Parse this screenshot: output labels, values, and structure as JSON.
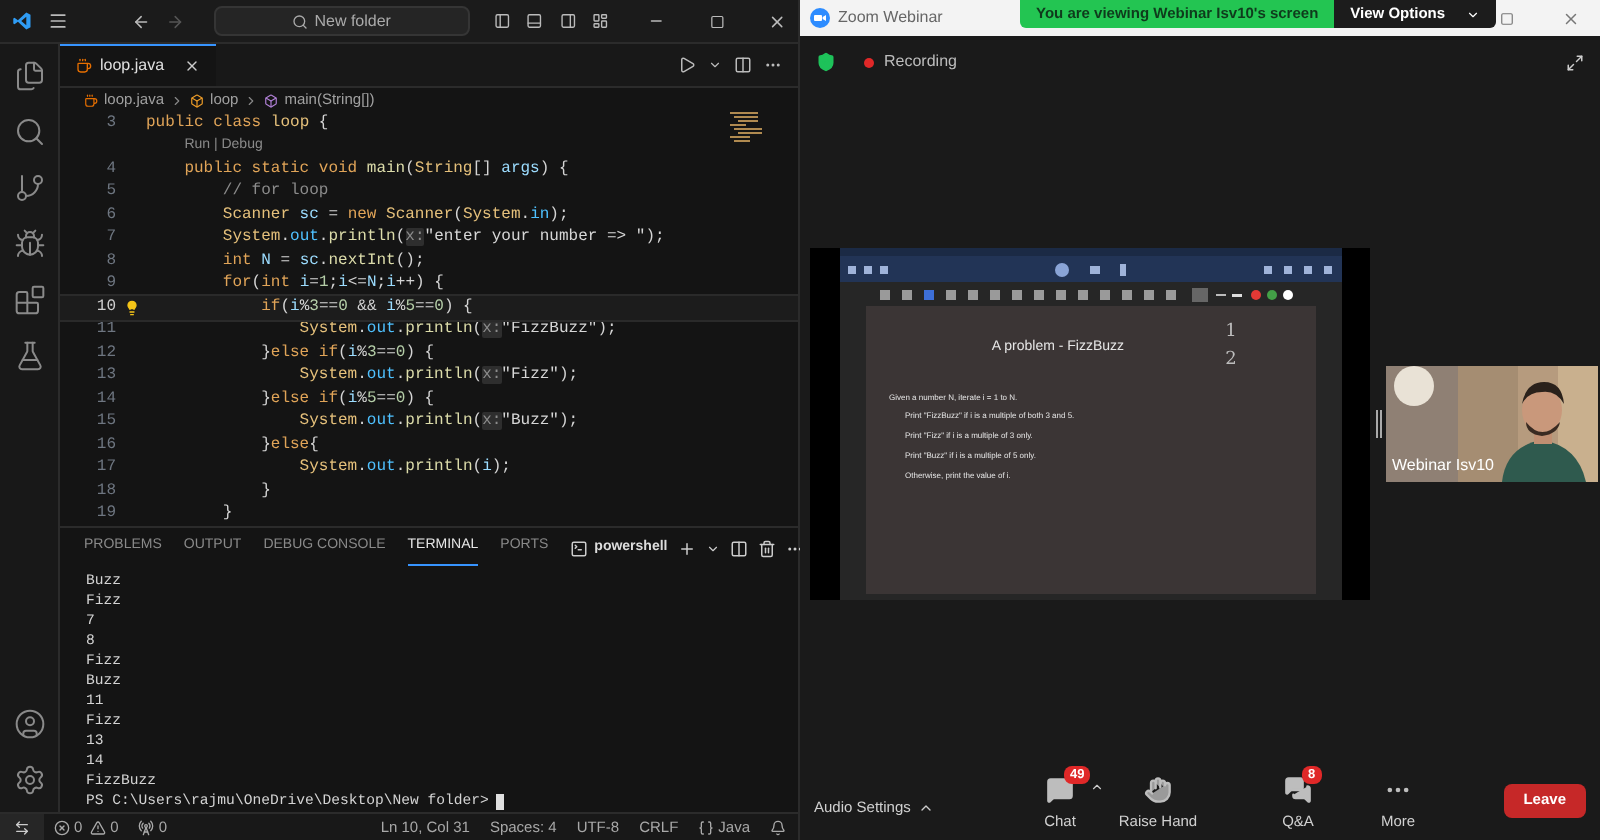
{
  "vscode": {
    "search": "New folder",
    "tab": {
      "label": "loop.java"
    },
    "breadcrumb": [
      "loop.java",
      "loop",
      "main(String[])"
    ],
    "code": [
      {
        "kind": "code",
        "number": "3",
        "current": false,
        "tokens": [
          {
            "kind": "kw",
            "text": "public class "
          },
          {
            "kind": "type",
            "text": "loop"
          },
          {
            "kind": "p",
            "text": " {"
          }
        ]
      },
      {
        "kind": "codelens",
        "text": "    Run | Debug"
      },
      {
        "kind": "code",
        "number": "4",
        "current": false,
        "tokens": [
          {
            "kind": "kw",
            "text": "    public static void "
          },
          {
            "kind": "fn",
            "text": "main"
          },
          {
            "kind": "p",
            "text": "("
          },
          {
            "kind": "type",
            "text": "String"
          },
          {
            "kind": "p",
            "text": "[] "
          },
          {
            "kind": "var",
            "text": "args"
          },
          {
            "kind": "p",
            "text": ") {"
          }
        ]
      },
      {
        "kind": "code",
        "number": "5",
        "current": false,
        "tokens": [
          {
            "kind": "com",
            "text": "        // for loop"
          }
        ]
      },
      {
        "kind": "code",
        "number": "6",
        "current": false,
        "tokens": [
          {
            "kind": "type",
            "text": "        Scanner "
          },
          {
            "kind": "var",
            "text": "sc"
          },
          {
            "kind": "p",
            "text": " = "
          },
          {
            "kind": "kw",
            "text": "new "
          },
          {
            "kind": "type",
            "text": "Scanner"
          },
          {
            "kind": "p",
            "text": "("
          },
          {
            "kind": "type",
            "text": "System"
          },
          {
            "kind": "p",
            "text": "."
          },
          {
            "kind": "field",
            "text": "in"
          },
          {
            "kind": "p",
            "text": ");"
          }
        ]
      },
      {
        "kind": "code",
        "number": "7",
        "current": false,
        "tokens": [
          {
            "kind": "type",
            "text": "        System"
          },
          {
            "kind": "p",
            "text": "."
          },
          {
            "kind": "field",
            "text": "out"
          },
          {
            "kind": "p",
            "text": "."
          },
          {
            "kind": "fn",
            "text": "println"
          },
          {
            "kind": "p",
            "text": "("
          },
          {
            "kind": "hint",
            "text": "x:"
          },
          {
            "kind": "str",
            "text": "\"enter your number => \""
          },
          {
            "kind": "p",
            "text": ");"
          }
        ]
      },
      {
        "kind": "code",
        "number": "8",
        "current": false,
        "tokens": [
          {
            "kind": "kw",
            "text": "        int "
          },
          {
            "kind": "var",
            "text": "N"
          },
          {
            "kind": "p",
            "text": " = "
          },
          {
            "kind": "var",
            "text": "sc"
          },
          {
            "kind": "p",
            "text": "."
          },
          {
            "kind": "fn",
            "text": "nextInt"
          },
          {
            "kind": "p",
            "text": "();"
          }
        ]
      },
      {
        "kind": "code",
        "number": "9",
        "current": false,
        "tokens": [
          {
            "kind": "kw",
            "text": "        for"
          },
          {
            "kind": "p",
            "text": "("
          },
          {
            "kind": "kw",
            "text": "int "
          },
          {
            "kind": "var",
            "text": "i"
          },
          {
            "kind": "p",
            "text": "="
          },
          {
            "kind": "num",
            "text": "1"
          },
          {
            "kind": "p",
            "text": ";"
          },
          {
            "kind": "var",
            "text": "i"
          },
          {
            "kind": "p",
            "text": "<="
          },
          {
            "kind": "var",
            "text": "N"
          },
          {
            "kind": "p",
            "text": ";"
          },
          {
            "kind": "var",
            "text": "i"
          },
          {
            "kind": "p",
            "text": "++) {"
          }
        ]
      },
      {
        "kind": "code",
        "number": "10",
        "current": true,
        "tokens": [
          {
            "kind": "kw",
            "text": "            if"
          },
          {
            "kind": "p",
            "text": "("
          },
          {
            "kind": "var",
            "text": "i"
          },
          {
            "kind": "p",
            "text": "%"
          },
          {
            "kind": "num",
            "text": "3"
          },
          {
            "kind": "p",
            "text": "=="
          },
          {
            "kind": "num",
            "text": "0"
          },
          {
            "kind": "p",
            "text": " && "
          },
          {
            "kind": "var",
            "text": "i"
          },
          {
            "kind": "p",
            "text": "%"
          },
          {
            "kind": "num",
            "text": "5"
          },
          {
            "kind": "p",
            "text": "=="
          },
          {
            "kind": "num",
            "text": "0"
          },
          {
            "kind": "p",
            "text": ") {"
          }
        ]
      },
      {
        "kind": "code",
        "number": "11",
        "current": false,
        "tokens": [
          {
            "kind": "type",
            "text": "                System"
          },
          {
            "kind": "p",
            "text": "."
          },
          {
            "kind": "field",
            "text": "out"
          },
          {
            "kind": "p",
            "text": "."
          },
          {
            "kind": "fn",
            "text": "println"
          },
          {
            "kind": "p",
            "text": "("
          },
          {
            "kind": "hint",
            "text": "x:"
          },
          {
            "kind": "str",
            "text": "\"FizzBuzz\""
          },
          {
            "kind": "p",
            "text": ");"
          }
        ]
      },
      {
        "kind": "code",
        "number": "12",
        "current": false,
        "tokens": [
          {
            "kind": "p",
            "text": "            }"
          },
          {
            "kind": "kw",
            "text": "else if"
          },
          {
            "kind": "p",
            "text": "("
          },
          {
            "kind": "var",
            "text": "i"
          },
          {
            "kind": "p",
            "text": "%"
          },
          {
            "kind": "num",
            "text": "3"
          },
          {
            "kind": "p",
            "text": "=="
          },
          {
            "kind": "num",
            "text": "0"
          },
          {
            "kind": "p",
            "text": ") {"
          }
        ]
      },
      {
        "kind": "code",
        "number": "13",
        "current": false,
        "tokens": [
          {
            "kind": "type",
            "text": "                System"
          },
          {
            "kind": "p",
            "text": "."
          },
          {
            "kind": "field",
            "text": "out"
          },
          {
            "kind": "p",
            "text": "."
          },
          {
            "kind": "fn",
            "text": "println"
          },
          {
            "kind": "p",
            "text": "("
          },
          {
            "kind": "hint",
            "text": "x:"
          },
          {
            "kind": "str",
            "text": "\"Fizz\""
          },
          {
            "kind": "p",
            "text": ");"
          }
        ]
      },
      {
        "kind": "code",
        "number": "14",
        "current": false,
        "tokens": [
          {
            "kind": "p",
            "text": "            }"
          },
          {
            "kind": "kw",
            "text": "else if"
          },
          {
            "kind": "p",
            "text": "("
          },
          {
            "kind": "var",
            "text": "i"
          },
          {
            "kind": "p",
            "text": "%"
          },
          {
            "kind": "num",
            "text": "5"
          },
          {
            "kind": "p",
            "text": "=="
          },
          {
            "kind": "num",
            "text": "0"
          },
          {
            "kind": "p",
            "text": ") {"
          }
        ]
      },
      {
        "kind": "code",
        "number": "15",
        "current": false,
        "tokens": [
          {
            "kind": "type",
            "text": "                System"
          },
          {
            "kind": "p",
            "text": "."
          },
          {
            "kind": "field",
            "text": "out"
          },
          {
            "kind": "p",
            "text": "."
          },
          {
            "kind": "fn",
            "text": "println"
          },
          {
            "kind": "p",
            "text": "("
          },
          {
            "kind": "hint",
            "text": "x:"
          },
          {
            "kind": "str",
            "text": "\"Buzz\""
          },
          {
            "kind": "p",
            "text": ");"
          }
        ]
      },
      {
        "kind": "code",
        "number": "16",
        "current": false,
        "tokens": [
          {
            "kind": "p",
            "text": "            }"
          },
          {
            "kind": "kw",
            "text": "else"
          },
          {
            "kind": "p",
            "text": "{"
          }
        ]
      },
      {
        "kind": "code",
        "number": "17",
        "current": false,
        "tokens": [
          {
            "kind": "type",
            "text": "                System"
          },
          {
            "kind": "p",
            "text": "."
          },
          {
            "kind": "field",
            "text": "out"
          },
          {
            "kind": "p",
            "text": "."
          },
          {
            "kind": "fn",
            "text": "println"
          },
          {
            "kind": "p",
            "text": "("
          },
          {
            "kind": "var",
            "text": "i"
          },
          {
            "kind": "p",
            "text": ");"
          }
        ]
      },
      {
        "kind": "code",
        "number": "18",
        "current": false,
        "tokens": [
          {
            "kind": "p",
            "text": "            }"
          }
        ]
      },
      {
        "kind": "code",
        "number": "19",
        "current": false,
        "tokens": [
          {
            "kind": "p",
            "text": "        }"
          }
        ]
      }
    ],
    "panel_tabs": [
      {
        "label": "PROBLEMS",
        "selected": false
      },
      {
        "label": "OUTPUT",
        "selected": false
      },
      {
        "label": "DEBUG CONSOLE",
        "selected": false
      },
      {
        "label": "TERMINAL",
        "selected": true
      },
      {
        "label": "PORTS",
        "selected": false
      }
    ],
    "terminal_name": "powershell",
    "terminal_lines": [
      "Buzz",
      "Fizz",
      "7",
      "8",
      "Fizz",
      "Buzz",
      "11",
      "Fizz",
      "13",
      "14",
      "FizzBuzz"
    ],
    "prompt": "PS C:\\Users\\rajmu\\OneDrive\\Desktop\\New folder>",
    "status": {
      "errors": "0",
      "warnings": "0",
      "ports": "0",
      "position": "Ln 10, Col 31",
      "spaces": "Spaces: 4",
      "encoding": "UTF-8",
      "eol": "CRLF",
      "language": "Java"
    }
  },
  "zoom": {
    "title": "Zoom Webinar",
    "banner": "You are viewing Webinar Isv10's screen",
    "view_options": "View Options",
    "recording": "Recording",
    "shared_screen": {
      "title": "A problem - FizzBuzz",
      "handwriting": [
        "1",
        "2"
      ],
      "intro": "Given a number N, iterate i = 1 to N.",
      "rules": [
        "Print \"FizzBuzz\" if i is a multiple of both 3 and 5.",
        "Print \"Fizz\" if i is a multiple of 3 only.",
        "Print \"Buzz\" if i is a multiple of 5 only.",
        "Otherwise, print the value of i."
      ]
    },
    "video": {
      "name": "Webinar Isv10"
    },
    "audio_settings": "Audio Settings",
    "controls": [
      {
        "kind": "chat",
        "label": "Chat",
        "badge": "49",
        "has_menu": true
      },
      {
        "kind": "hand",
        "label": "Raise Hand",
        "has_menu": false
      },
      {
        "kind": "qa",
        "label": "Q&A",
        "badge": "8",
        "has_menu": false
      },
      {
        "kind": "more",
        "label": "More",
        "has_menu": false
      }
    ],
    "leave": "Leave"
  }
}
